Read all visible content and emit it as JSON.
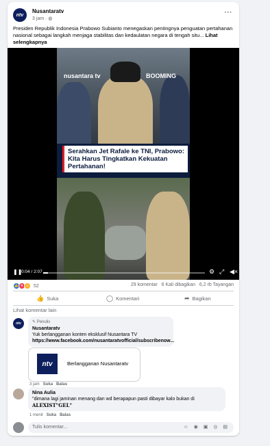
{
  "post": {
    "page_name": "Nusantaratv",
    "time": "3 jam ·",
    "globe_icon": "globe-icon",
    "more": "···",
    "caption": "Presiden Republik Indonesia Prabowo Subianto menegaskan pentingnya penguatan pertahanan nasional sebagai langkah menjaga stabilitas dan kedaulatan negara di tengah situ...",
    "see_more": "Lihat selengkapnya"
  },
  "video": {
    "logo_left": "nusantara tv",
    "logo_right": "BOOMING",
    "headline": "Serahkan Jet Rafale ke TNI, Prabowo: Kita Harus Tingkatkan Kekuatan Pertahanan!",
    "time": "0:04 / 2:07",
    "progress": 0.03
  },
  "stats": {
    "reaction_count": "52",
    "comments": "29 komentar",
    "shares": "6 Kali dibagikan",
    "views": "6,2 rb Tayangan"
  },
  "actions": {
    "like": "Suka",
    "comment": "Komentari",
    "share": "Bagikan"
  },
  "other_comments": "Lihat komentar lain",
  "comment1": {
    "tag": "Penulis",
    "author": "Nusantaratv",
    "text": "Yuk berlangganan konten eksklusif Nusantara TV",
    "link": "https://www.facebook.com/nusantaratvofficial/subscribenow...",
    "card_label": "Berlangganan Nusantaratv",
    "card_logo": "ntv",
    "time": "3 jam",
    "like": "Suka",
    "reply": "Balas"
  },
  "comment2": {
    "author": "Nina Aulia",
    "text": "\"dimana lagi jaminan menang dan wd berapapun pasti dibayar kalo bukan di",
    "text2": "ALEXIST\"GEL\"",
    "time": "1 menit",
    "like": "Suka",
    "reply": "Balas"
  },
  "input": {
    "placeholder": "Tulis komentar..."
  },
  "colors": {
    "brand": "#0d1f5c",
    "accent": "#1b74e4",
    "headline_red": "#e31b23"
  }
}
